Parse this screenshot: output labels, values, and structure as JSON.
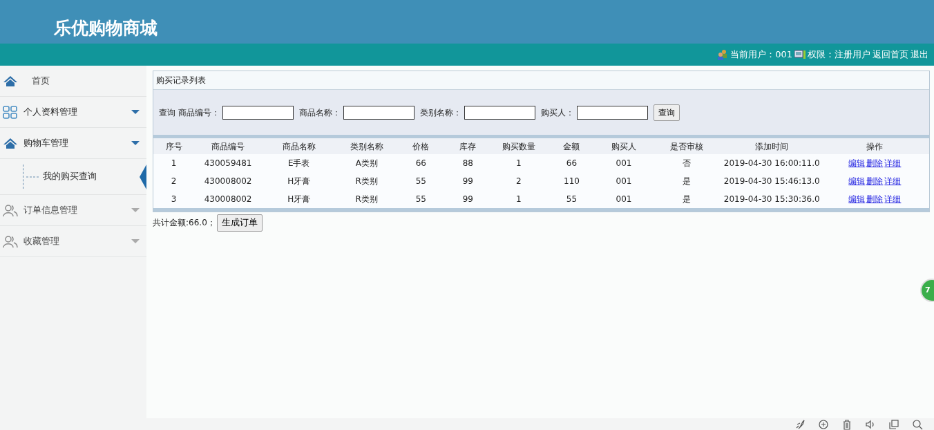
{
  "header": {
    "title": "乐优购物商城"
  },
  "topbar": {
    "user_label": "当前用户：001",
    "role_label": "权限：注册用户",
    "links": [
      "返回首页",
      "退出"
    ]
  },
  "sidebar": {
    "items": [
      {
        "kind": "home",
        "label": "首页",
        "has_caret": false,
        "emphasized": false
      },
      {
        "kind": "grid",
        "label": "个人资料管理",
        "has_caret": true,
        "emphasized": true
      },
      {
        "kind": "home",
        "label": "购物车管理",
        "has_caret": true,
        "emphasized": true,
        "children": [
          {
            "label": "我的购买查询",
            "selected": true
          }
        ]
      },
      {
        "kind": "people",
        "label": "订单信息管理",
        "has_caret": true,
        "emphasized": false
      },
      {
        "kind": "people",
        "label": "收藏管理",
        "has_caret": true,
        "emphasized": false
      }
    ]
  },
  "panel": {
    "title": "购买记录列表",
    "search_prefix": "查询",
    "fields": [
      {
        "label": "商品编号："
      },
      {
        "label": "商品名称："
      },
      {
        "label": "类别名称："
      },
      {
        "label": "购买人："
      }
    ],
    "search_button": "查询"
  },
  "table": {
    "columns": [
      "序号",
      "商品编号",
      "商品名称",
      "类别名称",
      "价格",
      "库存",
      "购买数量",
      "金额",
      "购买人",
      "是否审核",
      "添加时间",
      "操作"
    ],
    "rows": [
      {
        "cells": [
          "1",
          "430059481",
          "E手表",
          "A类别",
          "66",
          "88",
          "1",
          "66",
          "001",
          "否",
          "2019-04-30 16:00:11.0"
        ],
        "actions": [
          "编辑",
          "删除",
          "详细"
        ]
      },
      {
        "cells": [
          "2",
          "430008002",
          "H牙膏",
          "R类别",
          "55",
          "99",
          "2",
          "110",
          "001",
          "是",
          "2019-04-30 15:46:13.0"
        ],
        "actions": [
          "编辑",
          "删除",
          "详细"
        ]
      },
      {
        "cells": [
          "3",
          "430008002",
          "H牙膏",
          "R类别",
          "55",
          "99",
          "1",
          "55",
          "001",
          "是",
          "2019-04-30 15:30:36.0"
        ],
        "actions": [
          "编辑",
          "删除",
          "详细"
        ]
      }
    ]
  },
  "footer": {
    "total": "共计金额:66.0；",
    "button": "生成订单"
  },
  "floating_badge": "7"
}
